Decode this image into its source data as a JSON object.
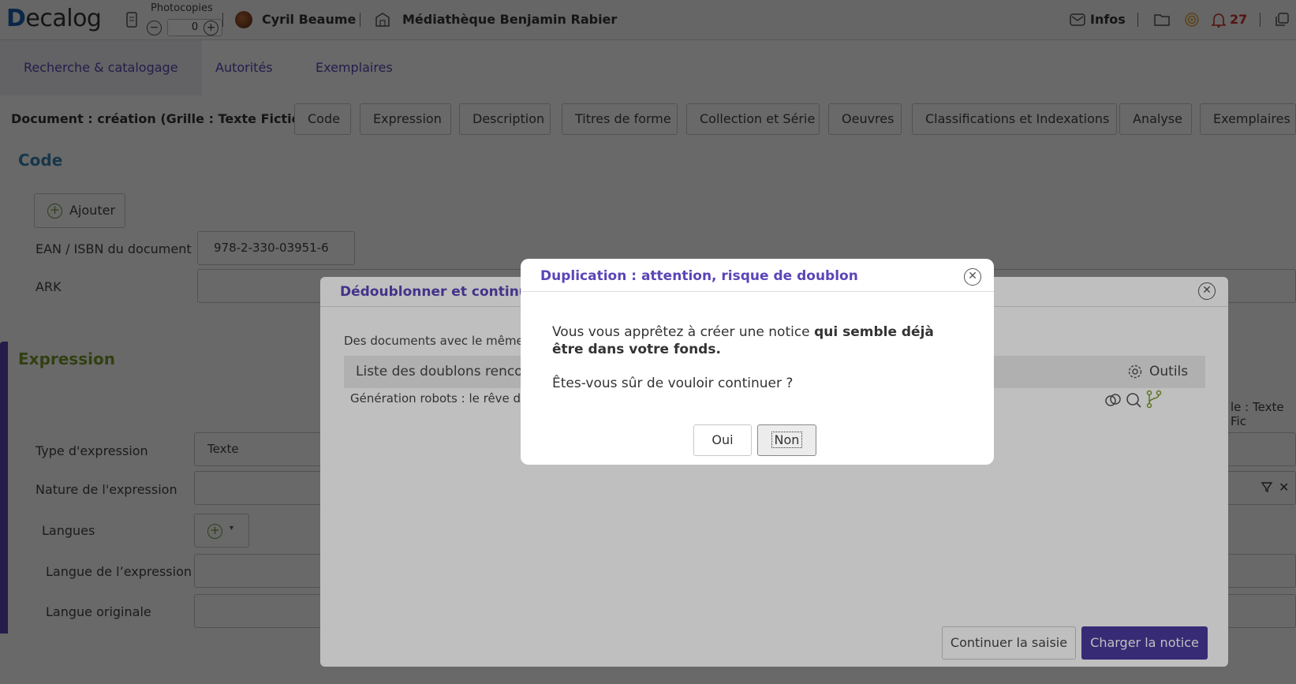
{
  "header": {
    "logo_text": "Decalog",
    "photocopies_label": "Photocopies",
    "photocopies_value": "0",
    "user_name": "Cyril Beaume",
    "library_name": "Médiathèque Benjamin Rabier",
    "infos_label": "Infos",
    "notification_count": "27"
  },
  "main_tabs": [
    {
      "label": "Recherche & catalogage",
      "active": true
    },
    {
      "label": "Autorités",
      "active": false
    },
    {
      "label": "Exemplaires",
      "active": false
    }
  ],
  "document_bar": {
    "title": "Document : création (Grille : Texte Fiction)",
    "sections": [
      "Code",
      "Expression",
      "Description",
      "Titres de forme",
      "Collection et Série",
      "Oeuvres",
      "Classifications et Indexations",
      "Analyse",
      "Exemplaires"
    ]
  },
  "form": {
    "code_heading": "Code",
    "add_label": "Ajouter",
    "ean_label": "EAN / ISBN du document",
    "ean_value": "978-2-330-03951-6",
    "ark_label": "ARK",
    "expression_heading": "Expression",
    "expression_type_label": "Type d'expression",
    "expression_type_value": "Texte",
    "expression_nature_label": "Nature de l'expression",
    "languages_label": "Langues",
    "expression_language_label": "Langue de l’expression",
    "original_language_label": "Langue originale",
    "grid_fragment": "le : Texte Fic"
  },
  "dedup_modal": {
    "title": "Dédoublonner et continue",
    "intro": "Des documents avec le même",
    "list_title": "Liste des doublons renco",
    "tools_label": "Outils",
    "row_text": "Génération robots : le rêve de",
    "continue_label": "Continuer la saisie",
    "load_label": "Charger la notice"
  },
  "confirm_dialog": {
    "title": "Duplication : attention, risque de doublon",
    "message_start": "Vous vous apprêtez à créer une notice ",
    "message_bold": "qui semble déjà être dans votre fonds.",
    "question": "Êtes-vous sûr de vouloir continuer ?",
    "yes_label": "Oui",
    "no_label": "Non"
  },
  "colors": {
    "accent": "#5b45b8",
    "code_heading": "#3a86b8",
    "expression_heading": "#7b9a2c",
    "notification": "#d0302a",
    "primary_button": "#4a3a9c"
  }
}
